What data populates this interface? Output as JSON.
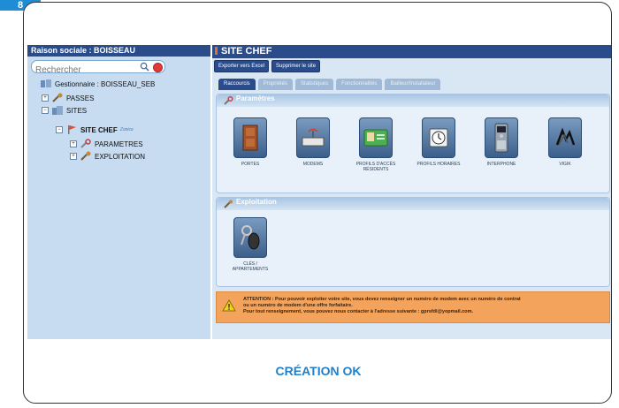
{
  "badge": "8",
  "left": {
    "header": "Raison sociale : BOISSEAU",
    "search_placeholder": "Rechercher",
    "tree": {
      "manager": "Gestionnaire : BOISSEAU_SEB",
      "passes": "PASSES",
      "sites": "SITES",
      "site_chef": "SITE CHEF",
      "site_tag": "Zonice",
      "parametres": "PARAMETRES",
      "exploitation": "EXPLOITATION"
    }
  },
  "right": {
    "title": "SITE CHEF",
    "toolbar": {
      "export": "Exporter vers Excel",
      "delete": "Supprimer le site"
    },
    "tabs": [
      "Raccourcis",
      "Propriétés",
      "Statistiques",
      "Fonctionnalités",
      "Bailleur/Installateur"
    ],
    "parametres": {
      "header": "Paramètres",
      "tiles": [
        "Portes",
        "Modems",
        "Profils d'accès Résidents",
        "Profils horaires",
        "Interphone",
        "VIGIK"
      ]
    },
    "exploitation": {
      "header": "Exploitation",
      "tiles": [
        "Clés / Appartements"
      ]
    },
    "alert": {
      "line1": "ATTENTION : Pour pouvoir exploiter votre site, vous devez renseigner un numéro de modem avec un numéro de contrat",
      "line2": "ou un numéro de modem d'une offre forfaitaire.",
      "line3": "Pour tout renseignement, vous pouvez nous contacter à l'adresse suivante : gprsfdi@yopmail.com."
    }
  },
  "caption": "CRÉATION OK",
  "colors": {
    "accent": "#1f7fc9",
    "header": "#2b4c8a",
    "alert": "#f4a35c"
  }
}
